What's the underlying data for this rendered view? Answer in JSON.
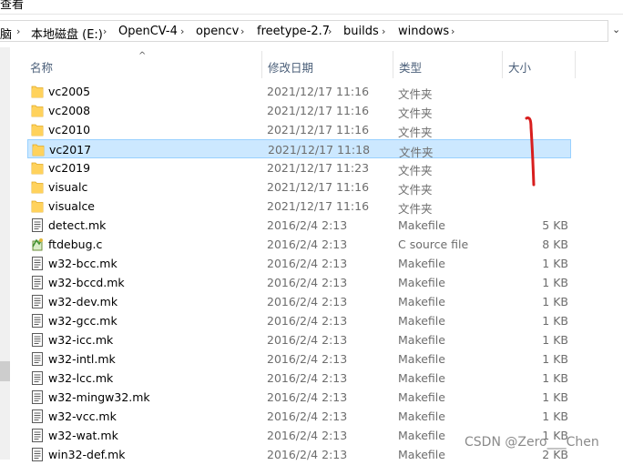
{
  "ribbon": {
    "label": "查看"
  },
  "address": {
    "crumbs": [
      "脑",
      "本地磁盘 (E:)",
      "OpenCV-4",
      "opencv",
      "freetype-2.7",
      "builds",
      "windows"
    ],
    "separator": "›",
    "dropdown": "⌄"
  },
  "columns": {
    "name": "名称",
    "date": "修改日期",
    "type": "类型",
    "size": "大小",
    "sort_indicator": "^"
  },
  "files": [
    {
      "name": "vc2005",
      "date": "2021/12/17 11:16",
      "type": "文件夹",
      "size": "",
      "icon": "folder-icon",
      "selected": false
    },
    {
      "name": "vc2008",
      "date": "2021/12/17 11:16",
      "type": "文件夹",
      "size": "",
      "icon": "folder-icon",
      "selected": false
    },
    {
      "name": "vc2010",
      "date": "2021/12/17 11:16",
      "type": "文件夹",
      "size": "",
      "icon": "folder-icon",
      "selected": false
    },
    {
      "name": "vc2017",
      "date": "2021/12/17 11:18",
      "type": "文件夹",
      "size": "",
      "icon": "folder-icon",
      "selected": true
    },
    {
      "name": "vc2019",
      "date": "2021/12/17 11:23",
      "type": "文件夹",
      "size": "",
      "icon": "folder-icon",
      "selected": false
    },
    {
      "name": "visualc",
      "date": "2021/12/17 11:16",
      "type": "文件夹",
      "size": "",
      "icon": "folder-icon",
      "selected": false
    },
    {
      "name": "visualce",
      "date": "2021/12/17 11:16",
      "type": "文件夹",
      "size": "",
      "icon": "folder-icon",
      "selected": false
    },
    {
      "name": "detect.mk",
      "date": "2016/2/4 2:13",
      "type": "Makefile",
      "size": "5 KB",
      "icon": "makefile-icon",
      "selected": false
    },
    {
      "name": "ftdebug.c",
      "date": "2016/2/4 2:13",
      "type": "C source file",
      "size": "8 KB",
      "icon": "c-source-icon",
      "selected": false
    },
    {
      "name": "w32-bcc.mk",
      "date": "2016/2/4 2:13",
      "type": "Makefile",
      "size": "1 KB",
      "icon": "makefile-icon",
      "selected": false
    },
    {
      "name": "w32-bccd.mk",
      "date": "2016/2/4 2:13",
      "type": "Makefile",
      "size": "1 KB",
      "icon": "makefile-icon",
      "selected": false
    },
    {
      "name": "w32-dev.mk",
      "date": "2016/2/4 2:13",
      "type": "Makefile",
      "size": "1 KB",
      "icon": "makefile-icon",
      "selected": false
    },
    {
      "name": "w32-gcc.mk",
      "date": "2016/2/4 2:13",
      "type": "Makefile",
      "size": "1 KB",
      "icon": "makefile-icon",
      "selected": false
    },
    {
      "name": "w32-icc.mk",
      "date": "2016/2/4 2:13",
      "type": "Makefile",
      "size": "1 KB",
      "icon": "makefile-icon",
      "selected": false
    },
    {
      "name": "w32-intl.mk",
      "date": "2016/2/4 2:13",
      "type": "Makefile",
      "size": "1 KB",
      "icon": "makefile-icon",
      "selected": false
    },
    {
      "name": "w32-lcc.mk",
      "date": "2016/2/4 2:13",
      "type": "Makefile",
      "size": "1 KB",
      "icon": "makefile-icon",
      "selected": false
    },
    {
      "name": "w32-mingw32.mk",
      "date": "2016/2/4 2:13",
      "type": "Makefile",
      "size": "1 KB",
      "icon": "makefile-icon",
      "selected": false
    },
    {
      "name": "w32-vcc.mk",
      "date": "2016/2/4 2:13",
      "type": "Makefile",
      "size": "1 KB",
      "icon": "makefile-icon",
      "selected": false
    },
    {
      "name": "w32-wat.mk",
      "date": "2016/2/4 2:13",
      "type": "Makefile",
      "size": "1 KB",
      "icon": "makefile-icon",
      "selected": false
    },
    {
      "name": "win32-def.mk",
      "date": "2016/2/4 2:13",
      "type": "Makefile",
      "size": "2 KB",
      "icon": "makefile-icon",
      "selected": false
    }
  ],
  "watermark": "CSDN @Zero___Chen",
  "colors": {
    "selection_bg": "#cce8ff",
    "selection_border": "#99d1ff",
    "folder": "#ffd25c",
    "annotation": "#d81e1e"
  }
}
